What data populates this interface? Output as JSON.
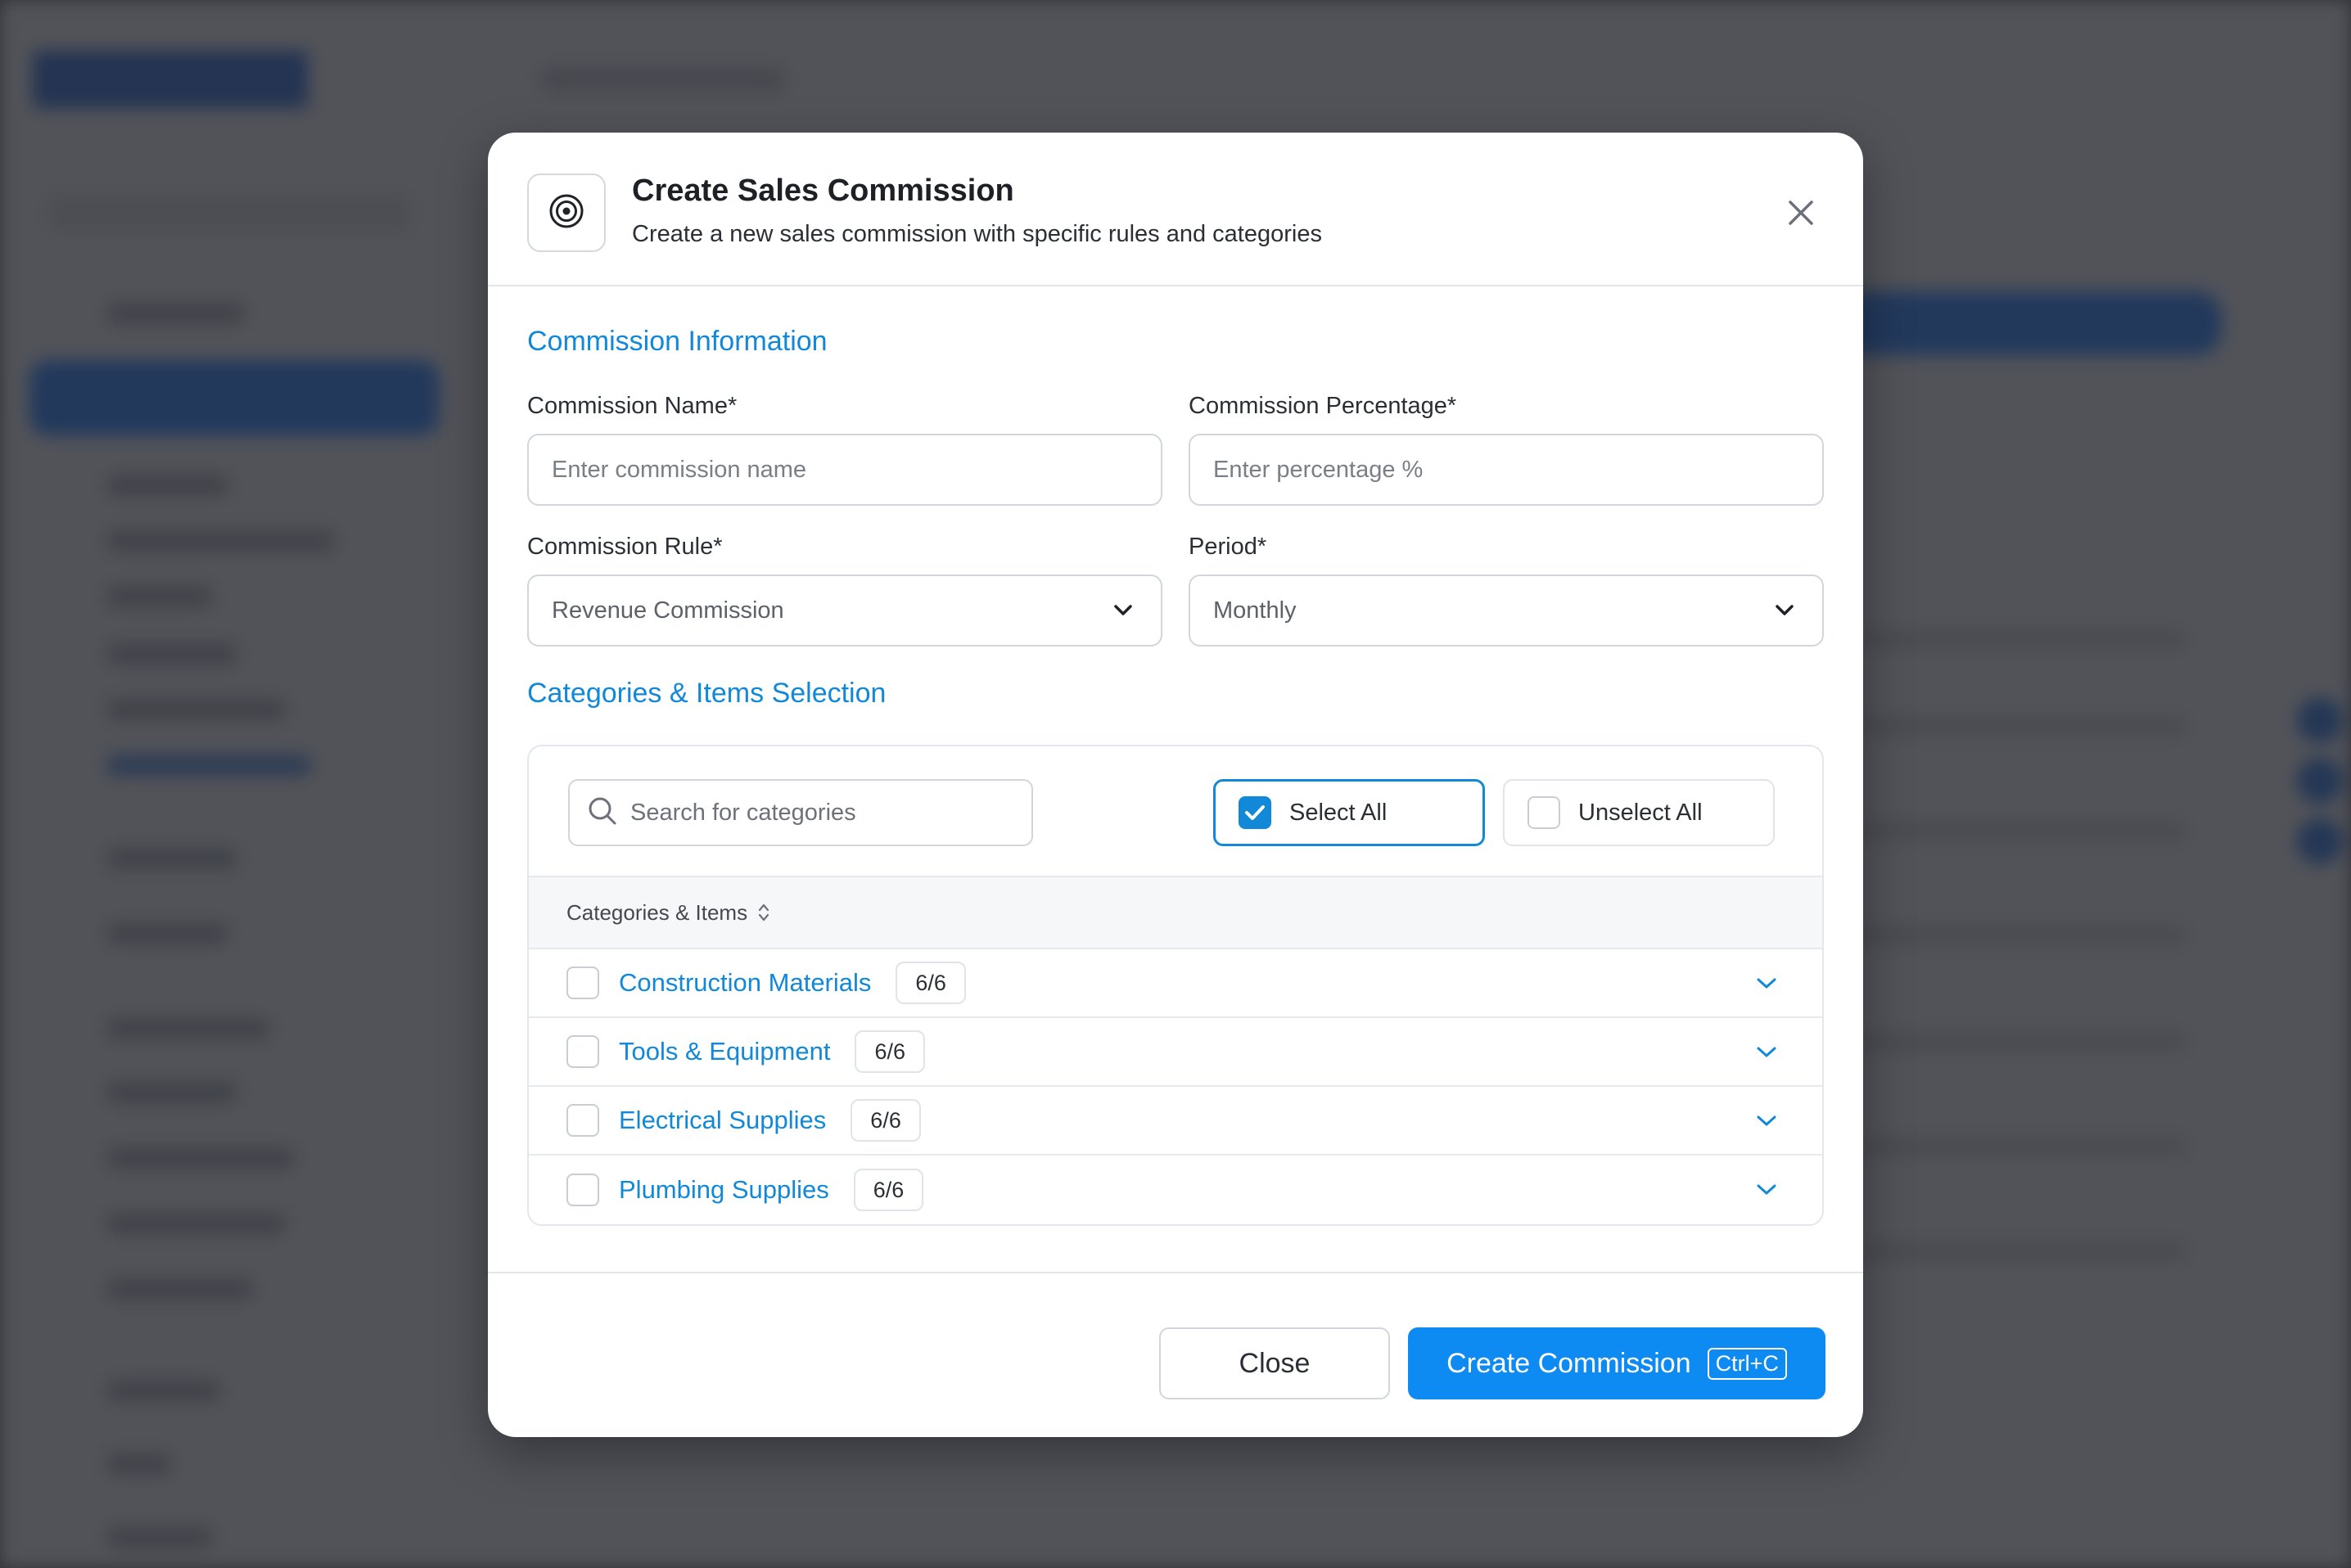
{
  "modal": {
    "title": "Create Sales Commission",
    "subtitle": "Create a new sales commission with specific rules and categories",
    "icon": "target-icon"
  },
  "commission_info": {
    "section_title": "Commission Information",
    "name": {
      "label": "Commission Name*",
      "placeholder": "Enter commission name",
      "value": ""
    },
    "percentage": {
      "label": "Commission Percentage*",
      "placeholder": "Enter percentage %",
      "value": ""
    },
    "rule": {
      "label": "Commission Rule*",
      "selected": "Revenue Commission"
    },
    "period": {
      "label": "Period*",
      "selected": "Monthly"
    }
  },
  "categories": {
    "section_title": "Categories & Items Selection",
    "search_placeholder": "Search for categories",
    "select_all_label": "Select All",
    "select_all_checked": true,
    "unselect_all_label": "Unselect All",
    "unselect_all_checked": false,
    "column_header": "Categories & Items",
    "items": [
      {
        "name": "Construction Materials",
        "count": "6/6",
        "checked": false
      },
      {
        "name": "Tools & Equipment",
        "count": "6/6",
        "checked": false
      },
      {
        "name": "Electrical Supplies",
        "count": "6/6",
        "checked": false
      },
      {
        "name": "Plumbing Supplies",
        "count": "6/6",
        "checked": false
      }
    ]
  },
  "footer": {
    "close_label": "Close",
    "create_label": "Create Commission",
    "create_shortcut": "Ctrl+C"
  },
  "colors": {
    "accent": "#1188d8",
    "primary_button": "#0d8bf2",
    "backdrop_overlay": "#26282e"
  }
}
